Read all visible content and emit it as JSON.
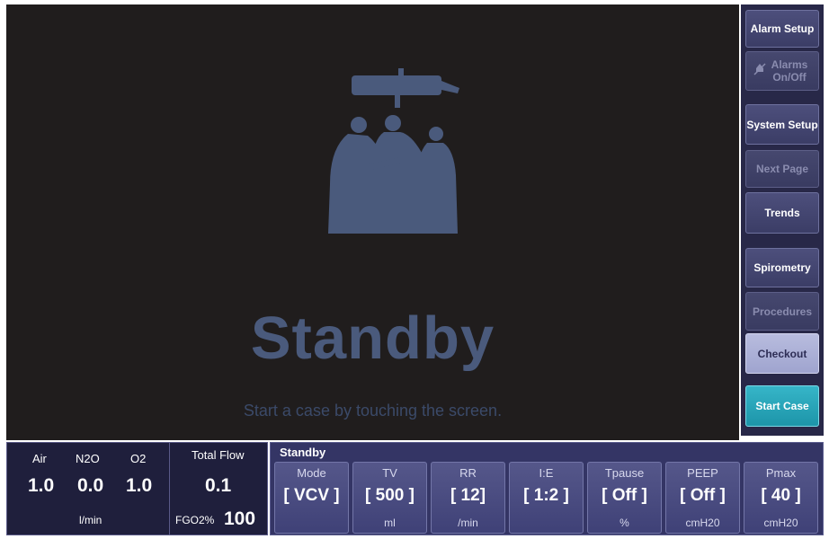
{
  "main": {
    "title": "Standby",
    "message": "Start a case by touching the screen."
  },
  "menu": {
    "alarm_setup": "Alarm Setup",
    "alarms_onoff": "Alarms On/Off",
    "system_setup": "System Setup",
    "next_page": "Next Page",
    "trends": "Trends",
    "spirometry": "Spirometry",
    "procedures": "Procedures",
    "checkout": "Checkout",
    "start_case": "Start Case"
  },
  "gas": {
    "air_label": "Air",
    "n2o_label": "N2O",
    "o2_label": "O2",
    "air_value": "1.0",
    "n2o_value": "0.0",
    "o2_value": "1.0",
    "flow_unit": "l/min",
    "total_flow_label": "Total Flow",
    "total_flow_value": "0.1",
    "fgo2_label": "FGO2%",
    "fgo2_value": "100"
  },
  "vent": {
    "title": "Standby",
    "params": [
      {
        "name": "Mode",
        "value": "[ VCV ]",
        "unit": ""
      },
      {
        "name": "TV",
        "value": "[ 500 ]",
        "unit": "ml"
      },
      {
        "name": "RR",
        "value": "[ 12]",
        "unit": "/min"
      },
      {
        "name": "I:E",
        "value": "[ 1:2 ]",
        "unit": ""
      },
      {
        "name": "Tpause",
        "value": "[ Off ]",
        "unit": "%"
      },
      {
        "name": "PEEP",
        "value": "[ Off ]",
        "unit": "cmH20"
      },
      {
        "name": "Pmax",
        "value": "[ 40 ]",
        "unit": "cmH20"
      }
    ]
  },
  "colors": {
    "background": "#201d1d",
    "illustration": "#4a5a7c",
    "menu_panel": "#282848",
    "start_case": "#2aa7ba",
    "checkout": "#aeb2d8"
  }
}
